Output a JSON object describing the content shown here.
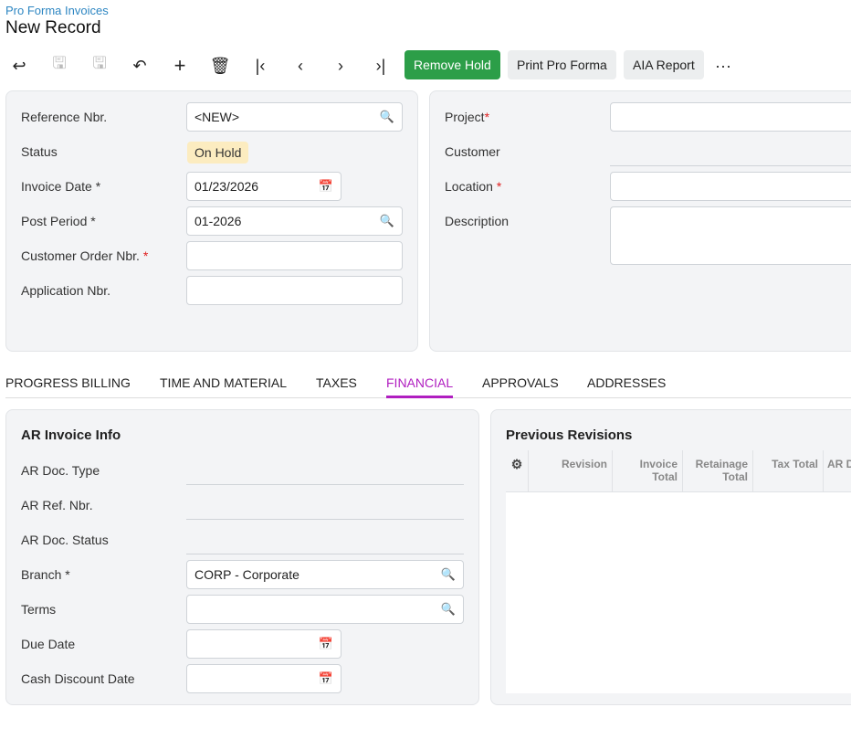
{
  "breadcrumb": "Pro Forma Invoices",
  "page_title": "New Record",
  "toolbar": {
    "remove_hold": "Remove Hold",
    "print_pro_forma": "Print Pro Forma",
    "aia_report": "AIA Report",
    "more": "···",
    "colors": {
      "remove_hold": "#2c9e48"
    }
  },
  "summary_left": {
    "reference_nbr": {
      "label": "Reference Nbr.",
      "value": "<NEW>"
    },
    "status": {
      "label": "Status",
      "value": "On Hold"
    },
    "invoice_date": {
      "label": "Invoice Date",
      "value": "01/23/2026"
    },
    "post_period": {
      "label": "Post Period",
      "value": "01-2026"
    },
    "customer_order_nbr": {
      "label": "Customer Order Nbr.",
      "value": ""
    },
    "application_nbr": {
      "label": "Application Nbr.",
      "value": ""
    }
  },
  "summary_right": {
    "project": {
      "label": "Project",
      "value": ""
    },
    "customer": {
      "label": "Customer",
      "value": ""
    },
    "location": {
      "label": "Location",
      "value": ""
    },
    "description": {
      "label": "Description",
      "value": ""
    }
  },
  "required_mark": "*",
  "tabs": [
    "PROGRESS BILLING",
    "TIME AND MATERIAL",
    "TAXES",
    "FINANCIAL",
    "APPROVALS",
    "ADDRESSES"
  ],
  "active_tab": "FINANCIAL",
  "ar_invoice_info": {
    "title": "AR Invoice Info",
    "ar_doc_type": {
      "label": "AR Doc. Type",
      "value": ""
    },
    "ar_ref_nbr": {
      "label": "AR Ref. Nbr.",
      "value": ""
    },
    "ar_doc_status": {
      "label": "AR Doc. Status",
      "value": ""
    },
    "branch": {
      "label": "Branch",
      "value": "CORP - Corporate"
    },
    "terms": {
      "label": "Terms",
      "value": ""
    },
    "due_date": {
      "label": "Due Date",
      "value": ""
    },
    "cash_discount_date": {
      "label": "Cash Discount Date",
      "value": ""
    }
  },
  "previous_revisions": {
    "title": "Previous Revisions",
    "columns": [
      "Revision",
      "Invoice Total",
      "Retainage Total",
      "Tax Total",
      "AR D"
    ],
    "rows": []
  }
}
